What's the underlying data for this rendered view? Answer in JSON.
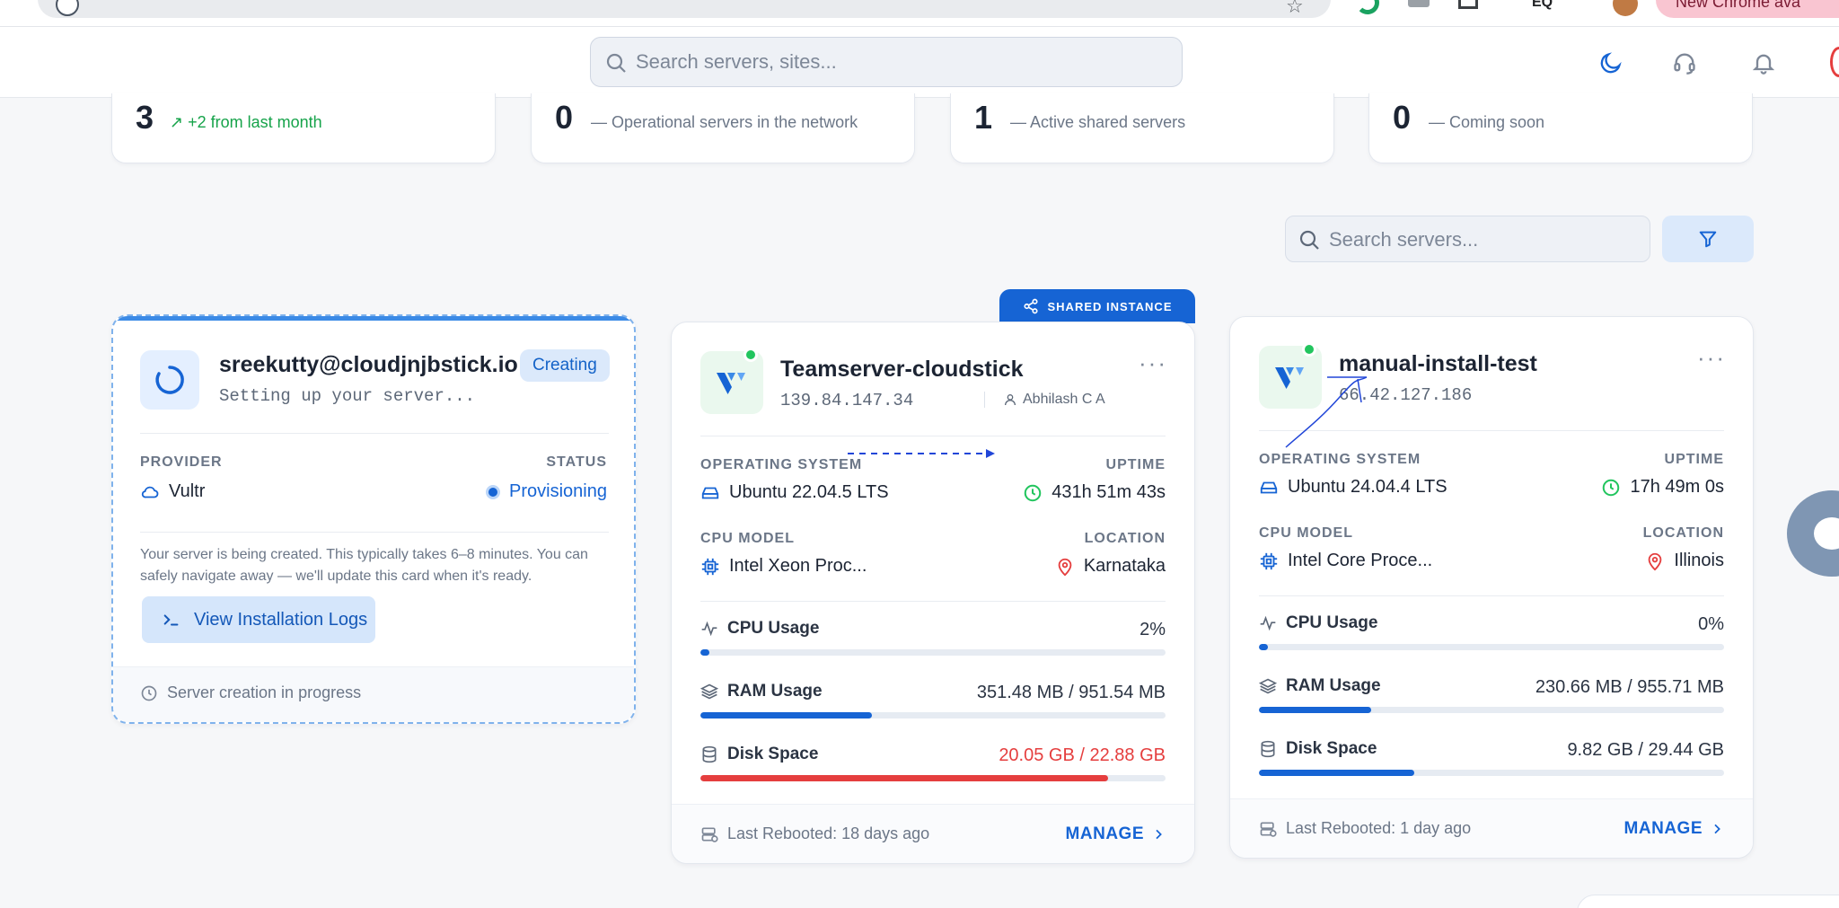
{
  "browser": {
    "extension_label": "EQ",
    "profile_pill": "New Chrome ava"
  },
  "header": {
    "search_placeholder": "Search servers, sites..."
  },
  "stats": [
    {
      "number": "3",
      "description": "↗ +2 from last month",
      "accent": "#16a34a"
    },
    {
      "number": "0",
      "description": "— Operational servers in the network"
    },
    {
      "number": "1",
      "description": "— Active shared servers"
    },
    {
      "number": "0",
      "description": "— Coming soon"
    }
  ],
  "filters": {
    "search_placeholder": "Search servers..."
  },
  "creating_card": {
    "title": "sreekutty@cloudjnjbstick.io",
    "subtitle": "Setting up your server...",
    "badge": "Creating",
    "provider_label": "PROVIDER",
    "provider_value": "Vultr",
    "status_label": "STATUS",
    "status_value": "Provisioning",
    "message": "Your server is being created. This typically takes 6–8 minutes. You can safely navigate away — we'll update this card when it's ready.",
    "logs_button": "View Installation Logs",
    "footer_text": "Server creation in progress"
  },
  "servers": [
    {
      "shared_badge": "SHARED INSTANCE",
      "name": "Teamserver-cloudstick",
      "ip": "139.84.147.34",
      "owner": "Abhilash C A",
      "os_label": "OPERATING SYSTEM",
      "os_value": "Ubuntu 22.04.5 LTS",
      "uptime_label": "UPTIME",
      "uptime_value": "431h 51m 43s",
      "cpu_model_label": "CPU MODEL",
      "cpu_model_value": "Intel Xeon Proc...",
      "location_label": "LOCATION",
      "location_value": "Karnataka",
      "cpu_usage_label": "CPU Usage",
      "cpu_usage_value": "2%",
      "cpu_usage_fraction": 0.02,
      "ram_label": "RAM Usage",
      "ram_value": "351.48 MB / 951.54 MB",
      "ram_fraction": 0.369,
      "disk_label": "Disk Space",
      "disk_value": "20.05 GB / 22.88 GB",
      "disk_fraction": 0.876,
      "reboot_text": "Last Rebooted: 18 days ago",
      "manage_label": "MANAGE"
    },
    {
      "name": "manual-install-test",
      "ip": "66.42.127.186",
      "os_label": "OPERATING SYSTEM",
      "os_value": "Ubuntu 24.04.4 LTS",
      "uptime_label": "UPTIME",
      "uptime_value": "17h 49m 0s",
      "cpu_model_label": "CPU MODEL",
      "cpu_model_value": "Intel Core Proce...",
      "location_label": "LOCATION",
      "location_value": "Illinois",
      "cpu_usage_label": "CPU Usage",
      "cpu_usage_value": "0%",
      "cpu_usage_fraction": 0.0,
      "ram_label": "RAM Usage",
      "ram_value": "230.66 MB / 955.71 MB",
      "ram_fraction": 0.241,
      "disk_label": "Disk Space",
      "disk_value": "9.82 GB / 29.44 GB",
      "disk_fraction": 0.334,
      "reboot_text": "Last Rebooted: 1 day ago",
      "manage_label": "MANAGE"
    }
  ],
  "colors": {
    "primary": "#1664d4",
    "danger": "#e53e3e",
    "success": "#22c55e"
  }
}
